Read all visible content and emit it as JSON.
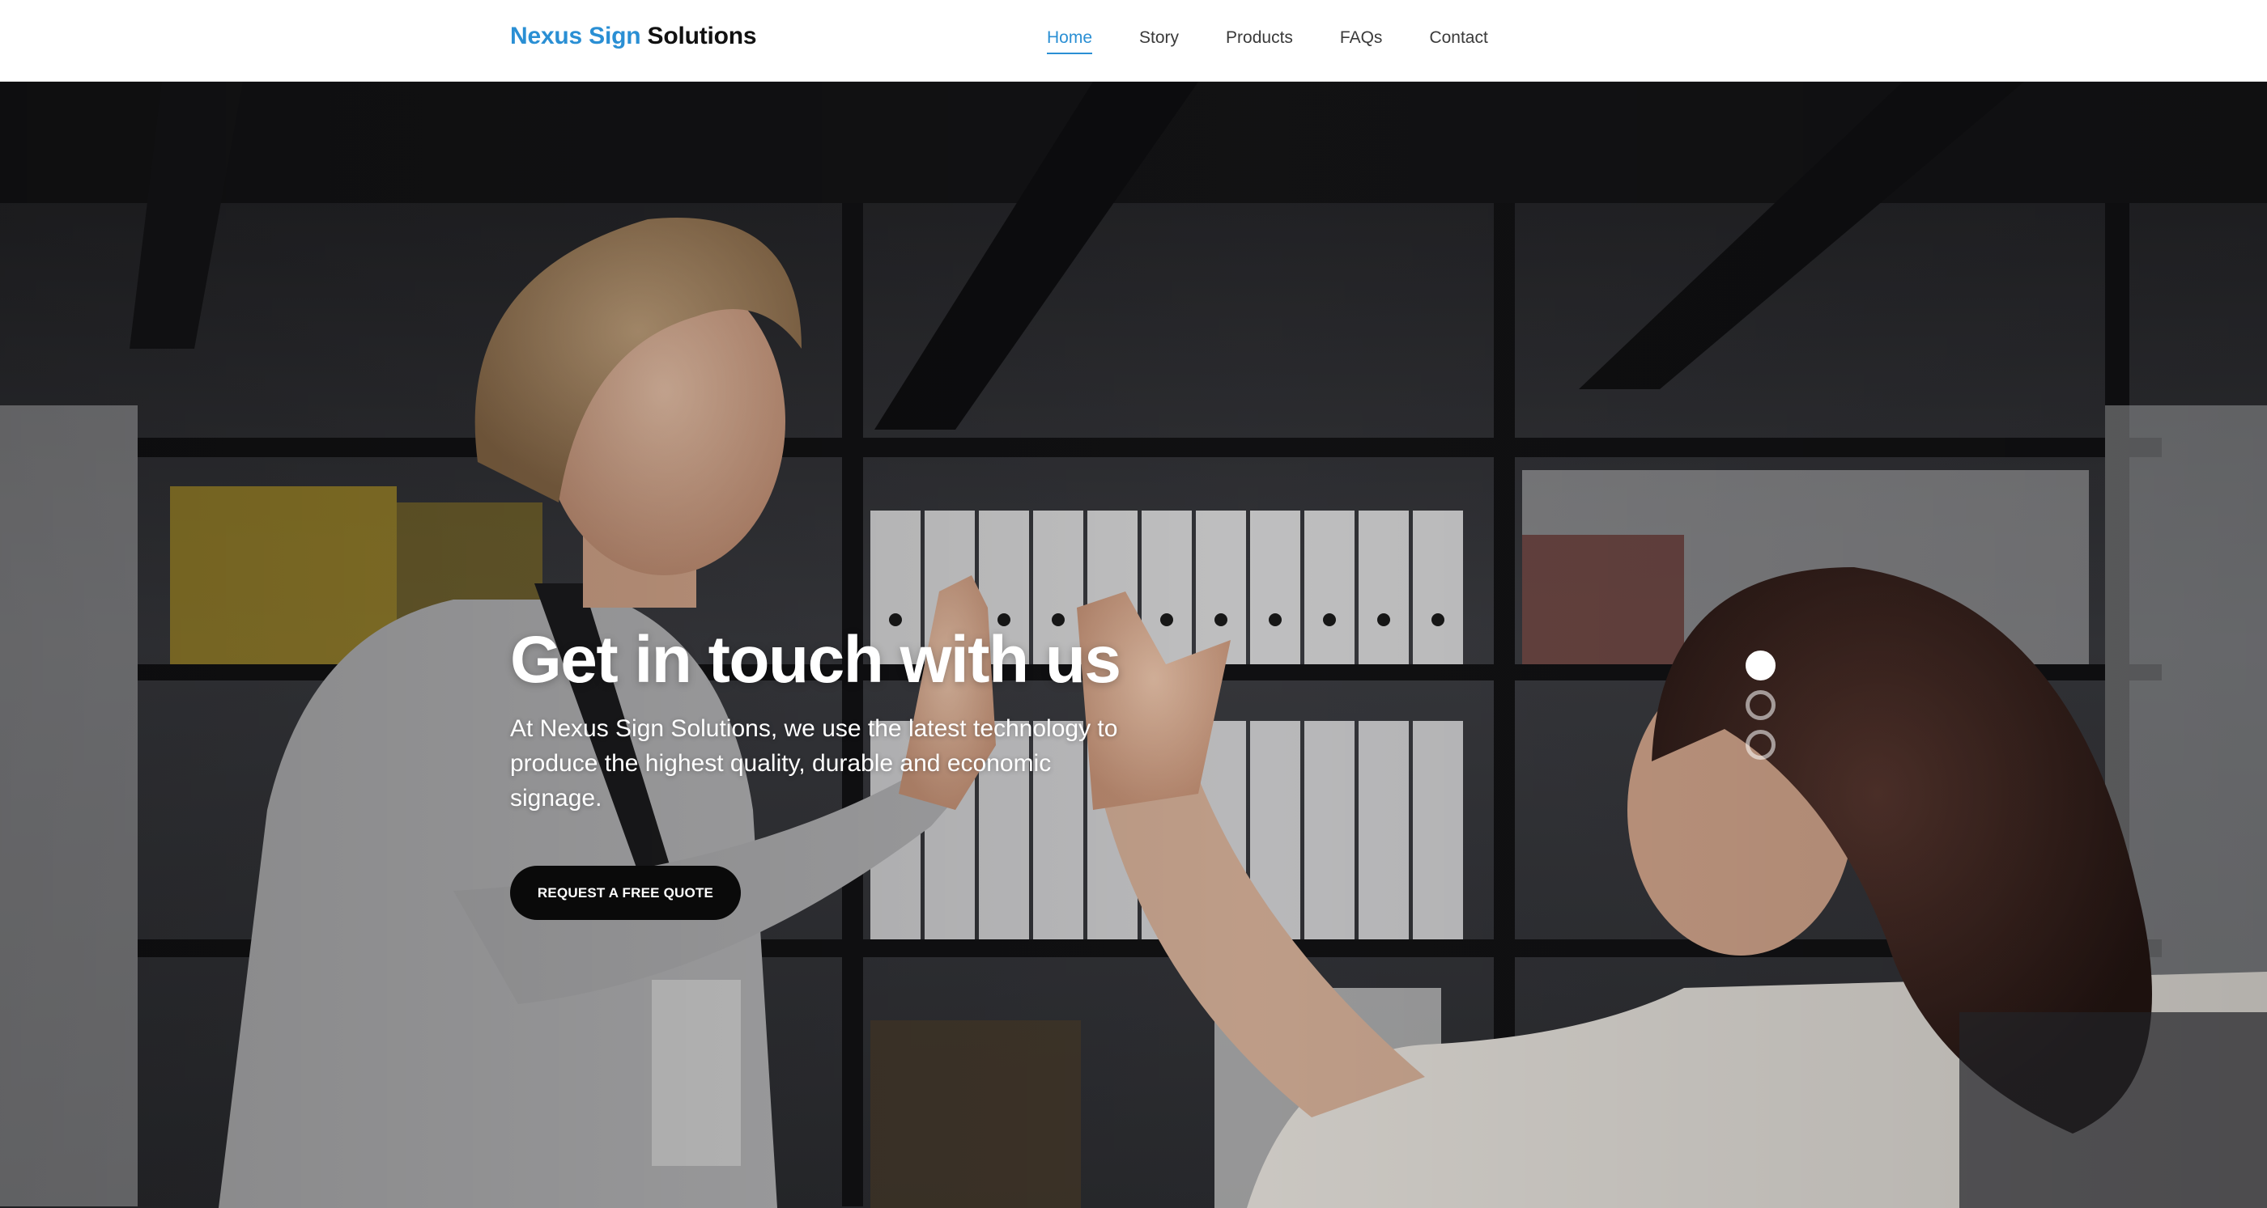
{
  "header": {
    "brand_accent": "Nexus Sign",
    "brand_rest": "Solutions",
    "nav": [
      {
        "label": "Home",
        "active": true
      },
      {
        "label": "Story",
        "active": false
      },
      {
        "label": "Products",
        "active": false
      },
      {
        "label": "FAQs",
        "active": false
      },
      {
        "label": "Contact",
        "active": false
      }
    ]
  },
  "hero": {
    "title": "Get in touch with us",
    "text": "At Nexus Sign Solutions, we use the latest technology to produce the highest quality, durable and economic signage.",
    "cta_label": "REQUEST A FREE QUOTE",
    "slides": 3,
    "active_slide": 1
  },
  "colors": {
    "accent": "#2a8fd4",
    "cta_bg": "#0a0a0a",
    "header_bg": "#ffffff"
  }
}
